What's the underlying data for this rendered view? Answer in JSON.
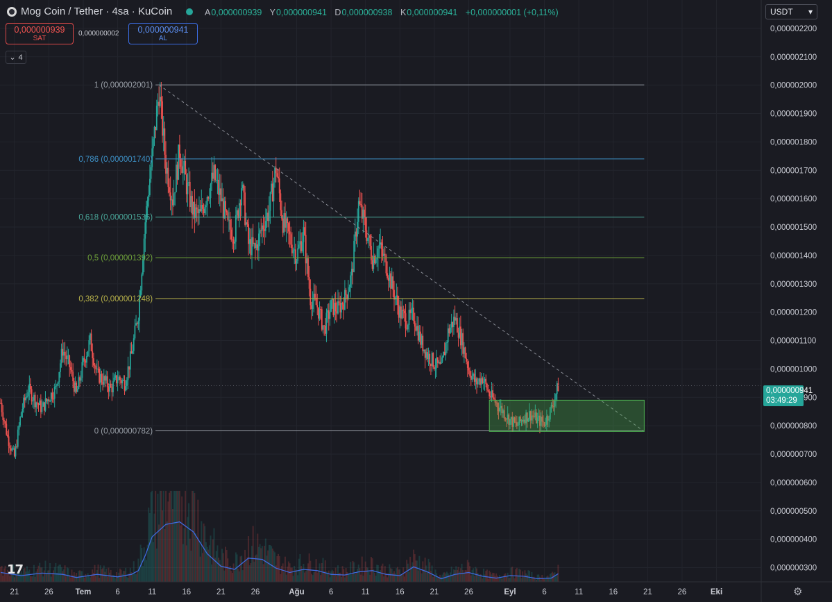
{
  "header": {
    "title": "Mog Coin / Tether · 4sa · KuCoin",
    "ohlc": [
      {
        "k": "A",
        "v": "0,000000939"
      },
      {
        "k": "Y",
        "v": "0,000000941"
      },
      {
        "k": "D",
        "v": "0,000000938"
      },
      {
        "k": "K",
        "v": "0,000000941"
      }
    ],
    "change": "+0,000000001 (+0,11%)"
  },
  "trade": {
    "sell_price": "0,000000939",
    "sell_label": "SAT",
    "spread": "0,000000002",
    "buy_price": "0,000000941",
    "buy_label": "AL"
  },
  "indicators_count": "4",
  "currency": "USDT",
  "last_price": {
    "value": "0,000000941",
    "countdown": "03:49:29",
    "price": 9.41e-07
  },
  "colors": {
    "background": "#1a1b22",
    "up": "#26a69a",
    "down": "#ef5350",
    "volume_ma": "#3f6ae0",
    "zone": "#4caf50",
    "grid": "#23252d"
  },
  "chart_data": {
    "type": "candlestick",
    "y_range": [
      2.5e-07,
      2.3e-06
    ],
    "y_ticks": [
      {
        "label": "0,000002200",
        "value": 2.2e-06
      },
      {
        "label": "0,000002100",
        "value": 2.1e-06
      },
      {
        "label": "0,000002000",
        "value": 2e-06
      },
      {
        "label": "0,000001900",
        "value": 1.9e-06
      },
      {
        "label": "0,000001800",
        "value": 1.8e-06
      },
      {
        "label": "0,000001700",
        "value": 1.7e-06
      },
      {
        "label": "0,000001600",
        "value": 1.6e-06
      },
      {
        "label": "0,000001500",
        "value": 1.5e-06
      },
      {
        "label": "0,000001400",
        "value": 1.4e-06
      },
      {
        "label": "0,000001300",
        "value": 1.3e-06
      },
      {
        "label": "0,000001200",
        "value": 1.2e-06
      },
      {
        "label": "0,000001100",
        "value": 1.1e-06
      },
      {
        "label": "0,000001000",
        "value": 1e-06
      },
      {
        "label": "0,000000900",
        "value": 9e-07
      },
      {
        "label": "0,000000800",
        "value": 8e-07
      },
      {
        "label": "0,000000700",
        "value": 7e-07
      },
      {
        "label": "0,000000600",
        "value": 6e-07
      },
      {
        "label": "0,000000500",
        "value": 5e-07
      },
      {
        "label": "0,000000400",
        "value": 4e-07
      },
      {
        "label": "0,000000300",
        "value": 3e-07
      }
    ],
    "x_ticks": [
      {
        "label": "21",
        "day": -9,
        "bold": false
      },
      {
        "label": "26",
        "day": -4,
        "bold": false
      },
      {
        "label": "Tem",
        "day": 1,
        "bold": true
      },
      {
        "label": "6",
        "day": 6,
        "bold": false
      },
      {
        "label": "11",
        "day": 11,
        "bold": false
      },
      {
        "label": "16",
        "day": 16,
        "bold": false
      },
      {
        "label": "21",
        "day": 21,
        "bold": false
      },
      {
        "label": "26",
        "day": 26,
        "bold": false
      },
      {
        "label": "Ağu",
        "day": 32,
        "bold": true
      },
      {
        "label": "6",
        "day": 37,
        "bold": false
      },
      {
        "label": "11",
        "day": 42,
        "bold": false
      },
      {
        "label": "16",
        "day": 47,
        "bold": false
      },
      {
        "label": "21",
        "day": 52,
        "bold": false
      },
      {
        "label": "26",
        "day": 57,
        "bold": false
      },
      {
        "label": "Eyl",
        "day": 63,
        "bold": true
      },
      {
        "label": "6",
        "day": 68,
        "bold": false
      },
      {
        "label": "11",
        "day": 73,
        "bold": false
      },
      {
        "label": "16",
        "day": 78,
        "bold": false
      },
      {
        "label": "21",
        "day": 83,
        "bold": false
      },
      {
        "label": "26",
        "day": 88,
        "bold": false
      },
      {
        "label": "Eki",
        "day": 93,
        "bold": true
      }
    ],
    "x_range": [
      -11.1,
      99.5
    ],
    "price_points": [
      {
        "day": -11,
        "price": 8.8e-07
      },
      {
        "day": -10,
        "price": 7.6e-07
      },
      {
        "day": -9,
        "price": 6.9e-07
      },
      {
        "day": -8,
        "price": 8.5e-07
      },
      {
        "day": -7,
        "price": 9.3e-07
      },
      {
        "day": -6,
        "price": 8.9e-07
      },
      {
        "day": -5,
        "price": 8.6e-07
      },
      {
        "day": -4,
        "price": 9e-07
      },
      {
        "day": -3,
        "price": 9.3e-07
      },
      {
        "day": -2,
        "price": 1.07e-06
      },
      {
        "day": -1,
        "price": 1.01e-06
      },
      {
        "day": 0,
        "price": 9.1e-07
      },
      {
        "day": 1,
        "price": 1.02e-06
      },
      {
        "day": 2,
        "price": 1.1e-06
      },
      {
        "day": 3,
        "price": 9.8e-07
      },
      {
        "day": 4,
        "price": 9.6e-07
      },
      {
        "day": 5,
        "price": 9.3e-07
      },
      {
        "day": 6,
        "price": 9.7e-07
      },
      {
        "day": 7,
        "price": 9.5e-07
      },
      {
        "day": 8,
        "price": 1.05e-06
      },
      {
        "day": 9,
        "price": 1.2e-06
      },
      {
        "day": 10,
        "price": 1.52e-06
      },
      {
        "day": 11,
        "price": 1.75e-06
      },
      {
        "day": 12,
        "price": 1.98e-06
      },
      {
        "day": 13,
        "price": 1.72e-06
      },
      {
        "day": 14,
        "price": 1.6e-06
      },
      {
        "day": 15,
        "price": 1.77e-06
      },
      {
        "day": 16,
        "price": 1.65e-06
      },
      {
        "day": 17,
        "price": 1.55e-06
      },
      {
        "day": 18,
        "price": 1.54e-06
      },
      {
        "day": 19,
        "price": 1.62e-06
      },
      {
        "day": 20,
        "price": 1.68e-06
      },
      {
        "day": 21,
        "price": 1.6e-06
      },
      {
        "day": 22,
        "price": 1.5e-06
      },
      {
        "day": 23,
        "price": 1.48e-06
      },
      {
        "day": 24,
        "price": 1.65e-06
      },
      {
        "day": 25,
        "price": 1.44e-06
      },
      {
        "day": 26,
        "price": 1.42e-06
      },
      {
        "day": 27,
        "price": 1.5e-06
      },
      {
        "day": 28,
        "price": 1.56e-06
      },
      {
        "day": 29,
        "price": 1.71e-06
      },
      {
        "day": 30,
        "price": 1.52e-06
      },
      {
        "day": 31,
        "price": 1.46e-06
      },
      {
        "day": 32,
        "price": 1.4e-06
      },
      {
        "day": 33,
        "price": 1.48e-06
      },
      {
        "day": 34,
        "price": 1.25e-06
      },
      {
        "day": 35,
        "price": 1.22e-06
      },
      {
        "day": 36,
        "price": 1.14e-06
      },
      {
        "day": 37,
        "price": 1.22e-06
      },
      {
        "day": 38,
        "price": 1.21e-06
      },
      {
        "day": 39,
        "price": 1.25e-06
      },
      {
        "day": 40,
        "price": 1.33e-06
      },
      {
        "day": 41,
        "price": 1.58e-06
      },
      {
        "day": 42,
        "price": 1.5e-06
      },
      {
        "day": 43,
        "price": 1.39e-06
      },
      {
        "day": 44,
        "price": 1.43e-06
      },
      {
        "day": 45,
        "price": 1.37e-06
      },
      {
        "day": 46,
        "price": 1.28e-06
      },
      {
        "day": 47,
        "price": 1.2e-06
      },
      {
        "day": 48,
        "price": 1.17e-06
      },
      {
        "day": 49,
        "price": 1.19e-06
      },
      {
        "day": 50,
        "price": 1.1e-06
      },
      {
        "day": 51,
        "price": 1.05e-06
      },
      {
        "day": 52,
        "price": 1.02e-06
      },
      {
        "day": 53,
        "price": 1e-06
      },
      {
        "day": 54,
        "price": 1.13e-06
      },
      {
        "day": 55,
        "price": 1.18e-06
      },
      {
        "day": 56,
        "price": 1.1e-06
      },
      {
        "day": 57,
        "price": 1e-06
      },
      {
        "day": 58,
        "price": 9.5e-07
      },
      {
        "day": 59,
        "price": 9.7e-07
      },
      {
        "day": 60,
        "price": 9.1e-07
      },
      {
        "day": 61,
        "price": 8.8e-07
      },
      {
        "day": 62,
        "price": 8.5e-07
      },
      {
        "day": 63,
        "price": 8.2e-07
      },
      {
        "day": 64,
        "price": 8e-07
      },
      {
        "day": 65,
        "price": 8.3e-07
      },
      {
        "day": 66,
        "price": 8.4e-07
      },
      {
        "day": 67,
        "price": 8.2e-07
      },
      {
        "day": 68,
        "price": 8.1e-07
      },
      {
        "day": 69,
        "price": 8.6e-07
      },
      {
        "day": 70,
        "price": 9.4e-07
      }
    ],
    "volume_ma": [
      {
        "day": -11,
        "v": 0.15
      },
      {
        "day": -8,
        "v": 0.1
      },
      {
        "day": -5,
        "v": 0.14
      },
      {
        "day": -2,
        "v": 0.12
      },
      {
        "day": 0,
        "v": 0.07
      },
      {
        "day": 3,
        "v": 0.12
      },
      {
        "day": 6,
        "v": 0.08
      },
      {
        "day": 8,
        "v": 0.12
      },
      {
        "day": 9,
        "v": 0.18
      },
      {
        "day": 10,
        "v": 0.42
      },
      {
        "day": 11,
        "v": 0.72
      },
      {
        "day": 13,
        "v": 0.92
      },
      {
        "day": 15,
        "v": 0.96
      },
      {
        "day": 17,
        "v": 0.8
      },
      {
        "day": 19,
        "v": 0.45
      },
      {
        "day": 21,
        "v": 0.25
      },
      {
        "day": 23,
        "v": 0.2
      },
      {
        "day": 25,
        "v": 0.38
      },
      {
        "day": 27,
        "v": 0.36
      },
      {
        "day": 29,
        "v": 0.22
      },
      {
        "day": 31,
        "v": 0.15
      },
      {
        "day": 33,
        "v": 0.2
      },
      {
        "day": 35,
        "v": 0.18
      },
      {
        "day": 37,
        "v": 0.12
      },
      {
        "day": 39,
        "v": 0.11
      },
      {
        "day": 41,
        "v": 0.16
      },
      {
        "day": 43,
        "v": 0.18
      },
      {
        "day": 45,
        "v": 0.12
      },
      {
        "day": 47,
        "v": 0.1
      },
      {
        "day": 49,
        "v": 0.24
      },
      {
        "day": 51,
        "v": 0.16
      },
      {
        "day": 53,
        "v": 0.05
      },
      {
        "day": 55,
        "v": 0.12
      },
      {
        "day": 57,
        "v": 0.15
      },
      {
        "day": 59,
        "v": 0.09
      },
      {
        "day": 61,
        "v": 0.06
      },
      {
        "day": 63,
        "v": 0.1
      },
      {
        "day": 65,
        "v": 0.09
      },
      {
        "day": 67,
        "v": 0.05
      },
      {
        "day": 69,
        "v": 0.06
      },
      {
        "day": 70,
        "v": 0.13
      }
    ],
    "fib_levels": [
      {
        "label": "1 (0,000002001)",
        "price": 2.001e-06,
        "color": "#9aa0a8"
      },
      {
        "label": "0,786 (0,000001740)",
        "price": 1.74e-06,
        "color": "#3d8fc4"
      },
      {
        "label": "0,618 (0,000001535)",
        "price": 1.535e-06,
        "color": "#4aa89a"
      },
      {
        "label": "0,5 (0,000001392)",
        "price": 1.392e-06,
        "color": "#6fa33a"
      },
      {
        "label": "0,382 (0,000001248)",
        "price": 1.248e-06,
        "color": "#b8b24a"
      },
      {
        "label": "0 (0,000000782)",
        "price": 7.82e-07,
        "color": "#9aa0a8"
      }
    ],
    "fib_range_days": [
      12,
      82.5
    ],
    "trendline": [
      {
        "day": 12,
        "price": 2.001e-06
      },
      {
        "day": 82.5,
        "price": 7.8e-07
      }
    ],
    "zone": {
      "day_start": 60,
      "day_end": 82.5,
      "price_low": 7.8e-07,
      "price_high": 8.9e-07
    }
  }
}
